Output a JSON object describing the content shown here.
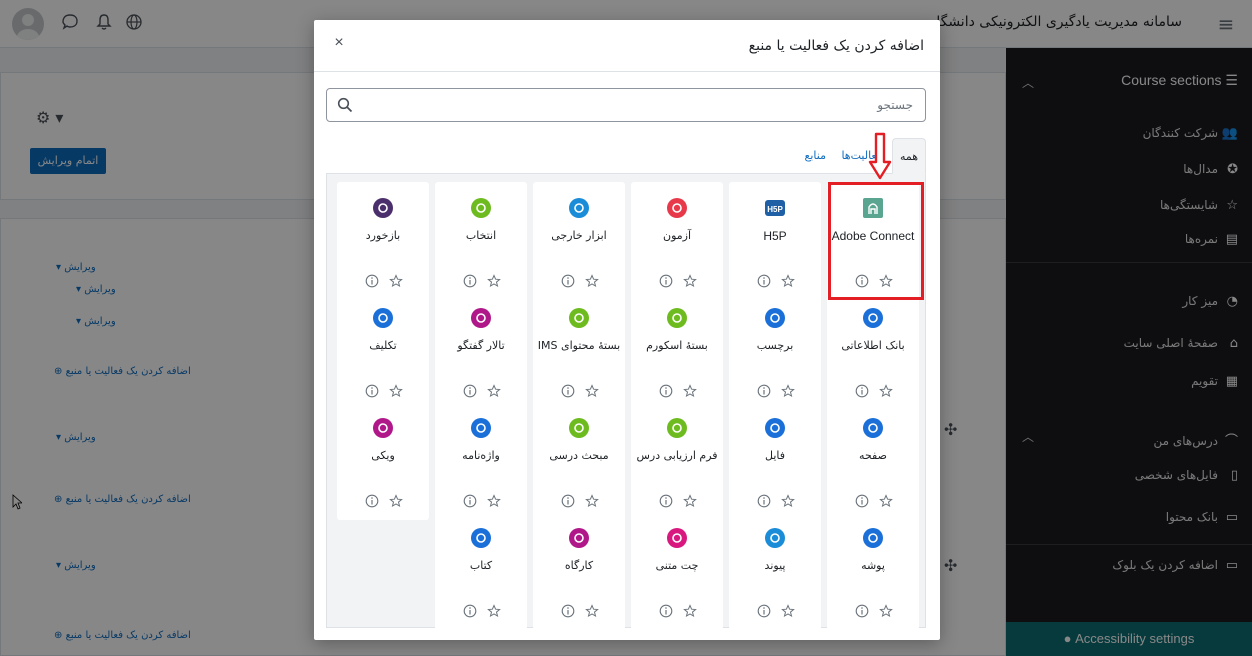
{
  "header": {
    "site_title": "سامانه مدیریت یادگیری الکترونیکی دانشگاه",
    "burger_icon": "hamburger-icon"
  },
  "drawer": {
    "heading": "Course sections",
    "items": [
      {
        "label": "شرکت کنندگان",
        "icon": "users-icon"
      },
      {
        "label": "مدال‌ها",
        "icon": "badge-icon"
      },
      {
        "label": "شایستگی‌ها",
        "icon": "star-outline-icon"
      },
      {
        "label": "نمره‌ها",
        "icon": "gradebook-icon"
      },
      {
        "label": "میز کار",
        "icon": "dashboard-icon"
      },
      {
        "label": "صفحهٔ اصلی سایت",
        "icon": "home-icon"
      },
      {
        "label": "تقویم",
        "icon": "calendar-icon"
      },
      {
        "label": "درس‌های من",
        "icon": "graduation-cap-icon"
      },
      {
        "label": "فایل‌های شخصی",
        "icon": "file-icon"
      },
      {
        "label": "بانک محتوا",
        "icon": "clipboard-icon"
      },
      {
        "label": "اضافه کردن یک بلوک",
        "icon": "folder-icon"
      }
    ],
    "accessibility": "Accessibility settings"
  },
  "background": {
    "finish_edit": "اتمام ویرایش",
    "edit": "ویرایش",
    "add_activity": "اضافه کردن یک فعالیت یا منبع"
  },
  "modal": {
    "title": "اضافه کردن یک فعالیت یا منبع",
    "close_label": "×",
    "search_placeholder": "جستجو",
    "tabs": [
      {
        "label": "همه",
        "active": true
      },
      {
        "label": "فعالیت‌ها",
        "active": false
      },
      {
        "label": "منابع",
        "active": false
      }
    ],
    "tiles": [
      {
        "name": "Adobe Connect",
        "color": "#5aa590",
        "icon": "adobe-connect-icon"
      },
      {
        "name": "H5P",
        "color": "#1f5fa6",
        "icon": "h5p-icon"
      },
      {
        "name": "آزمون",
        "color": "#e8394b",
        "icon": "quiz-icon"
      },
      {
        "name": "ابزار خارجی",
        "color": "#1a8cd8",
        "icon": "external-tool-icon"
      },
      {
        "name": "انتخاب",
        "color": "#6dbb1f",
        "icon": "choice-icon"
      },
      {
        "name": "بازخورد",
        "color": "#4b2f6c",
        "icon": "feedback-icon"
      },
      {
        "name": "بانک اطلاعاتی",
        "color": "#1a6fd8",
        "icon": "database-icon"
      },
      {
        "name": "برچسب",
        "color": "#1a6fd8",
        "icon": "label-icon"
      },
      {
        "name": "بستهٔ اسکورم",
        "color": "#6dbb1f",
        "icon": "scorm-icon"
      },
      {
        "name": "بستهٔ محتوای IMS",
        "color": "#6dbb1f",
        "icon": "ims-package-icon"
      },
      {
        "name": "تالار گفتگو",
        "color": "#b0188a",
        "icon": "forum-icon"
      },
      {
        "name": "تکلیف",
        "color": "#1a6fd8",
        "icon": "assignment-icon"
      },
      {
        "name": "صفحه",
        "color": "#1a6fd8",
        "icon": "page-icon"
      },
      {
        "name": "فایل",
        "color": "#1a6fd8",
        "icon": "file-resource-icon"
      },
      {
        "name": "فرم ارزیابی درس",
        "color": "#6dbb1f",
        "icon": "survey-icon"
      },
      {
        "name": "مبحث درسی",
        "color": "#6dbb1f",
        "icon": "lesson-icon"
      },
      {
        "name": "واژه‌نامه",
        "color": "#1a6fd8",
        "icon": "glossary-icon"
      },
      {
        "name": "ویکی",
        "color": "#b0188a",
        "icon": "wiki-icon"
      },
      {
        "name": "پوشه",
        "color": "#1a6fd8",
        "icon": "folder-resource-icon"
      },
      {
        "name": "پیوند",
        "color": "#1a8cd8",
        "icon": "url-icon"
      },
      {
        "name": "چت متنی",
        "color": "#d8187e",
        "icon": "chat-icon"
      },
      {
        "name": "کارگاه",
        "color": "#b0188a",
        "icon": "workshop-icon"
      },
      {
        "name": "کتاب",
        "color": "#1a6fd8",
        "icon": "book-icon"
      }
    ]
  },
  "annotation": {
    "highlight_color": "#e31e24"
  }
}
